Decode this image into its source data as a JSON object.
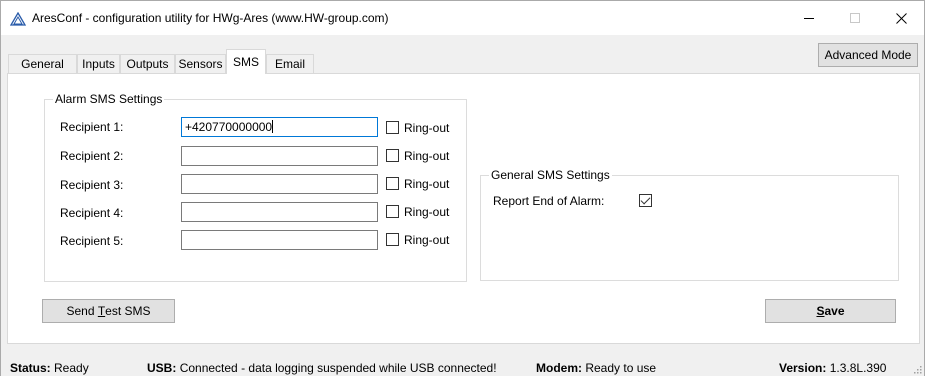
{
  "window": {
    "title": "AresConf - configuration utility for HWg-Ares (www.HW-group.com)"
  },
  "toolbar": {
    "advanced_mode_label": "Advanced Mode"
  },
  "tabs": [
    {
      "label": "General",
      "active": false
    },
    {
      "label": "Inputs",
      "active": false
    },
    {
      "label": "Outputs",
      "active": false
    },
    {
      "label": "Sensors",
      "active": false
    },
    {
      "label": "SMS",
      "active": true
    },
    {
      "label": "Email",
      "active": false
    }
  ],
  "alarm_sms": {
    "group_label": "Alarm SMS Settings",
    "ringout_label": "Ring-out",
    "recipients": [
      {
        "label": "Recipient 1:",
        "value": "+420770000000",
        "ringout": false
      },
      {
        "label": "Recipient 2:",
        "value": "",
        "ringout": false
      },
      {
        "label": "Recipient 3:",
        "value": "",
        "ringout": false
      },
      {
        "label": "Recipient 4:",
        "value": "",
        "ringout": false
      },
      {
        "label": "Recipient 5:",
        "value": "",
        "ringout": false
      }
    ]
  },
  "general_sms": {
    "group_label": "General SMS Settings",
    "report_end_label": "Report End of Alarm:",
    "report_end_checked": true
  },
  "actions": {
    "send_test_prefix": "Send ",
    "send_test_mnemonic": "T",
    "send_test_suffix": "est SMS",
    "save_mnemonic": "S",
    "save_suffix": "ave"
  },
  "status": {
    "status_key": "Status:",
    "status_value": "Ready",
    "usb_key": "USB:",
    "usb_value": "Connected - data logging suspended while USB connected!",
    "modem_key": "Modem:",
    "modem_value": "Ready to use",
    "version_key": "Version:",
    "version_value": "1.3.8L.390"
  },
  "colors": {
    "focus_border": "#0078d7",
    "panel": "#ffffff",
    "chrome": "#f0f0f0"
  }
}
